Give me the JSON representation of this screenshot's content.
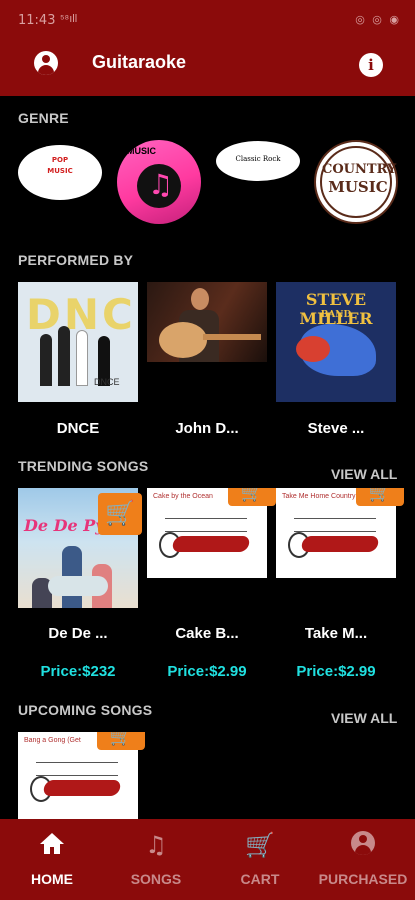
{
  "status_bar": {
    "time": "11:43",
    "signal": "⁵⁸ıll",
    "right_icons": "◎ ◎ ◉"
  },
  "app_bar": {
    "title": "Guitaraoke"
  },
  "genre": {
    "title": "GENRE",
    "items": [
      {
        "name": "POP MUSIC",
        "line1": "POP",
        "line2": "MUSIC"
      },
      {
        "name": "MUSIC",
        "label": "MUSIC"
      },
      {
        "name": "Classic Rock",
        "label": "Classic Rock"
      },
      {
        "name": "COUNTRY MUSIC",
        "line1": "COUNTRY",
        "line2": "MUSIC"
      }
    ]
  },
  "performed_by": {
    "title": "PERFORMED BY",
    "items": [
      {
        "label": "DNCE",
        "art_text": "DNCE"
      },
      {
        "label": "John D..."
      },
      {
        "label": "Steve ...",
        "art_title": "STEVE MILLER",
        "art_sub": "BAND"
      }
    ]
  },
  "trending": {
    "title": "TRENDING SONGS",
    "view_all": "VIEW ALL",
    "items": [
      {
        "label": "De De ...",
        "price": "Price:$232",
        "art_title": "De De Pyaar"
      },
      {
        "label": "Cake B...",
        "price": "Price:$2.99",
        "art_top": "Cake by the Ocean"
      },
      {
        "label": "Take M...",
        "price": "Price:$2.99",
        "art_top": "Take Me Home Country"
      }
    ]
  },
  "upcoming": {
    "title": "UPCOMING SONGS",
    "view_all": "VIEW ALL",
    "items": [
      {
        "art_top": "Bang a Gong (Get"
      }
    ]
  },
  "bottom_nav": [
    {
      "label": "HOME",
      "icon": "home-icon",
      "active": true
    },
    {
      "label": "SONGS",
      "icon": "♫",
      "active": false
    },
    {
      "label": "CART",
      "icon": "🛒",
      "active": false
    },
    {
      "label": "PURCHASED",
      "icon": "user-icon",
      "active": false
    }
  ],
  "colors": {
    "primary": "#8b0b0b",
    "accent": "#ef7f1a",
    "price": "#20e0e0",
    "background": "#000000"
  },
  "glyphs": {
    "cart": "🛒",
    "info": "i",
    "note": "♫"
  }
}
